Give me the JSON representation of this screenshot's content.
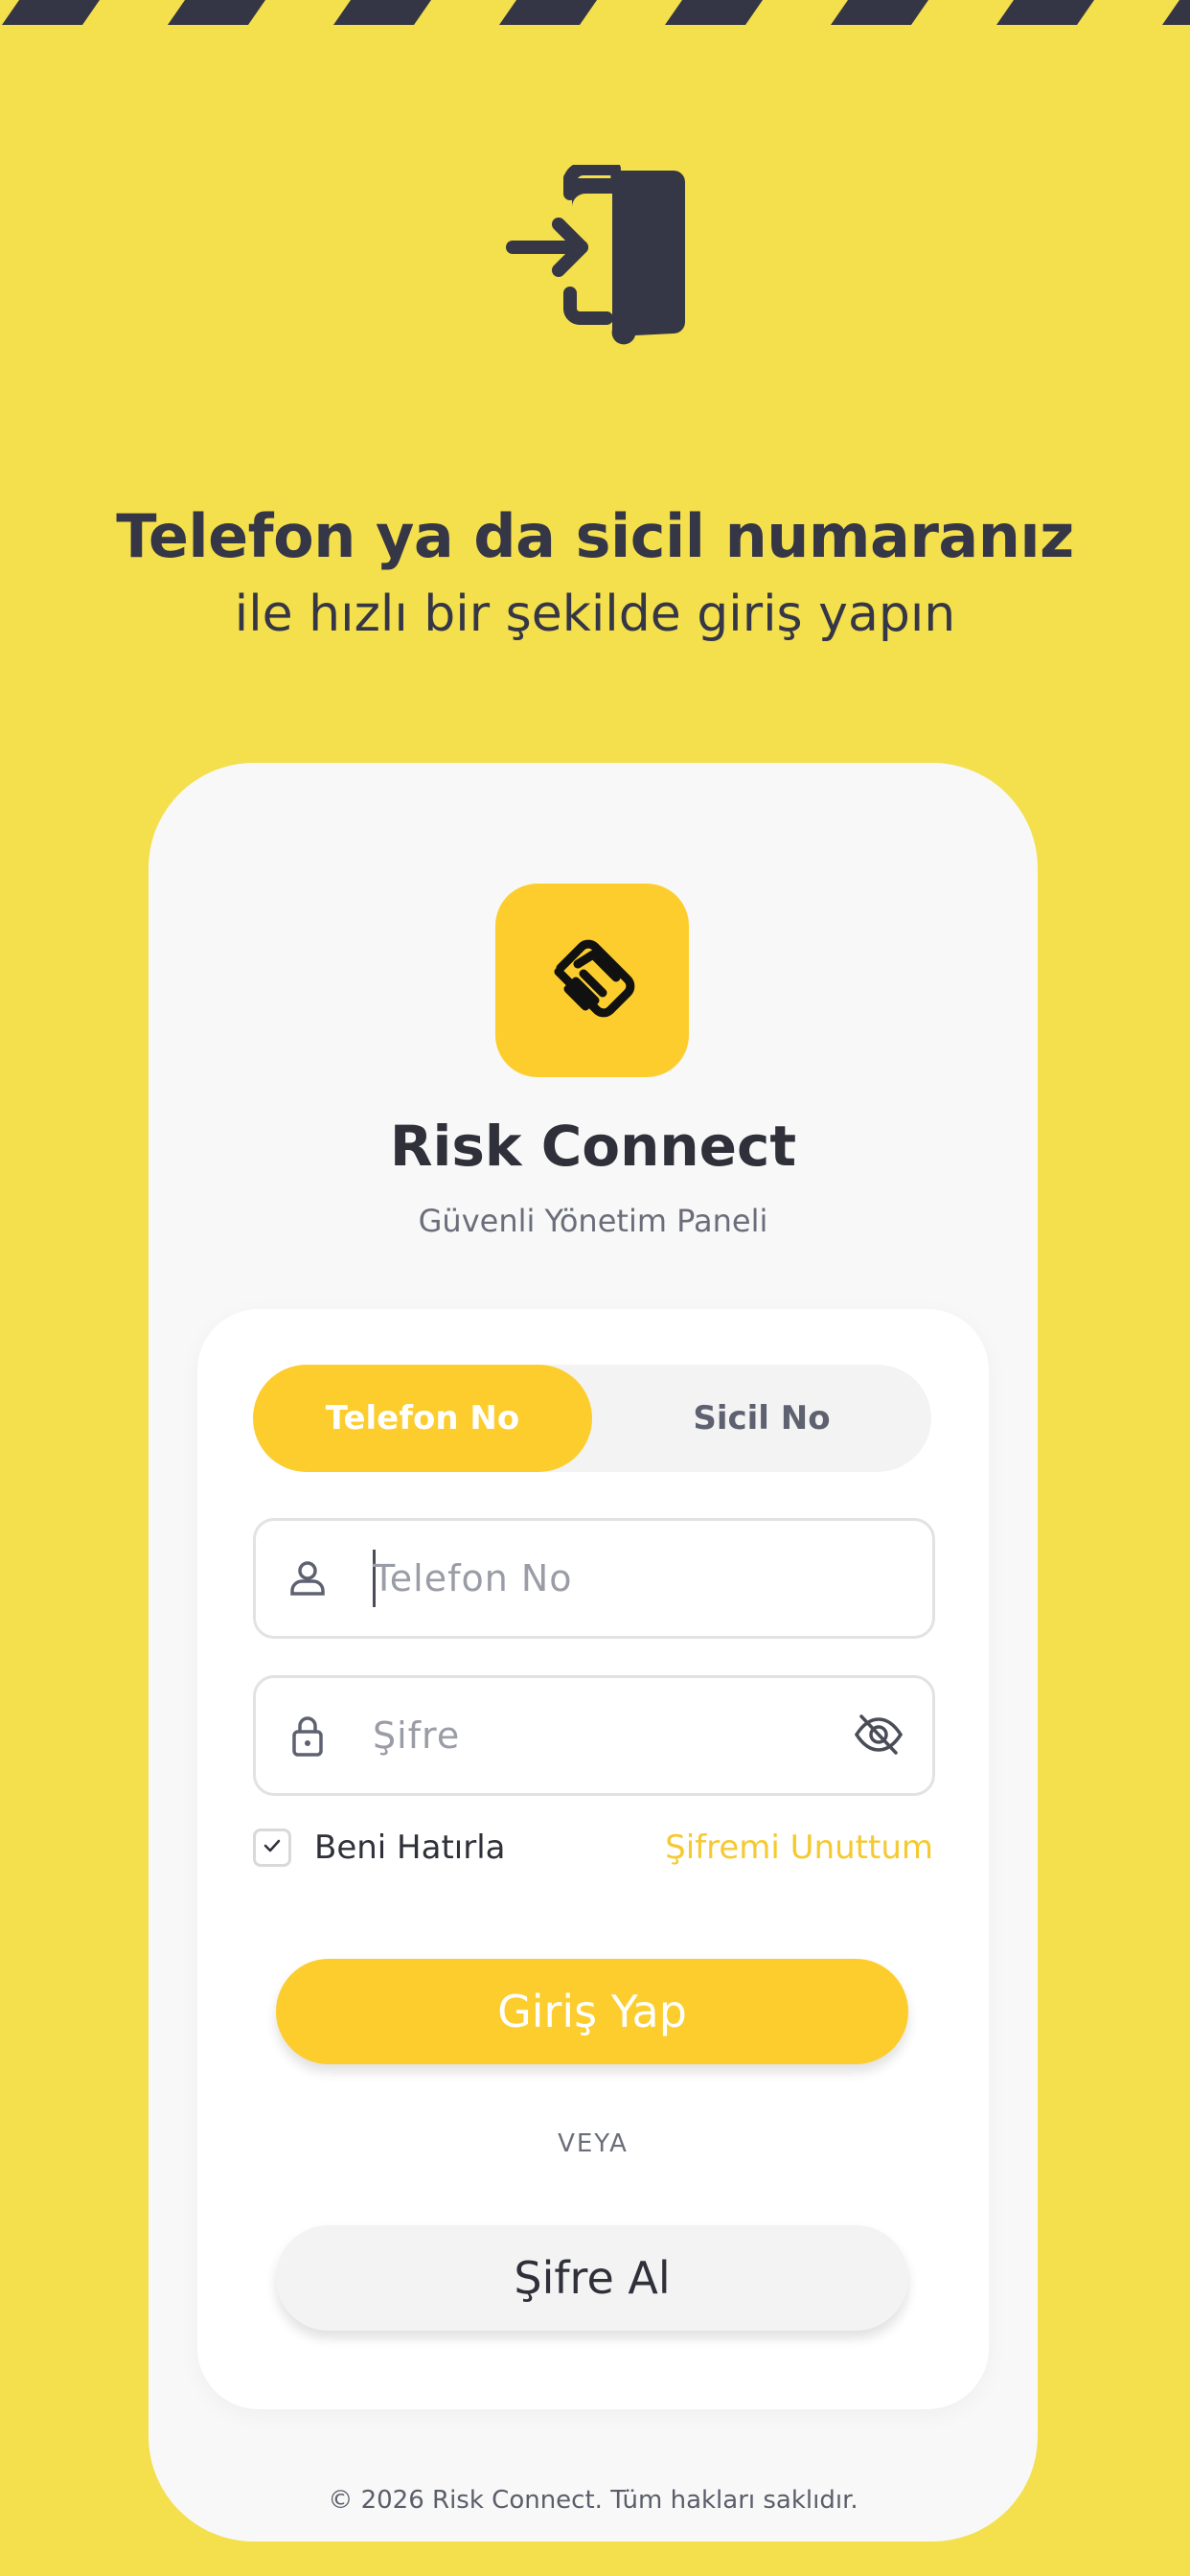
{
  "hero": {
    "title": "Telefon ya da sicil numaranız",
    "subtitle": "ile hızlı bir şekilde giriş yapın"
  },
  "app": {
    "name": "Risk Connect",
    "tagline": "Güvenli Yönetim Paneli"
  },
  "tabs": [
    {
      "label": "Telefon No",
      "active": true
    },
    {
      "label": "Sicil No",
      "active": false
    }
  ],
  "fields": {
    "phone_placeholder": "Telefon No",
    "password_placeholder": "Şifre"
  },
  "remember_me": {
    "label": "Beni Hatırla",
    "checked": true
  },
  "forgot_password": "Şifremi Unuttum",
  "login_button": "Giriş Yap",
  "or_divider": "VEYA",
  "get_password_button": "Şifre Al",
  "footer": "© 2026 Risk Connect. Tüm hakları saklıdır.",
  "icons": {
    "hero": "login-door-icon",
    "logo": "handshake-icon",
    "phone_field": "user-icon",
    "password_field": "lock-icon",
    "password_toggle": "eye-off-icon",
    "checkbox": "check-icon"
  },
  "colors": {
    "background": "#F4DF4D",
    "accent": "#FCCD2D",
    "dark": "#353646",
    "link": "#F6C930"
  }
}
